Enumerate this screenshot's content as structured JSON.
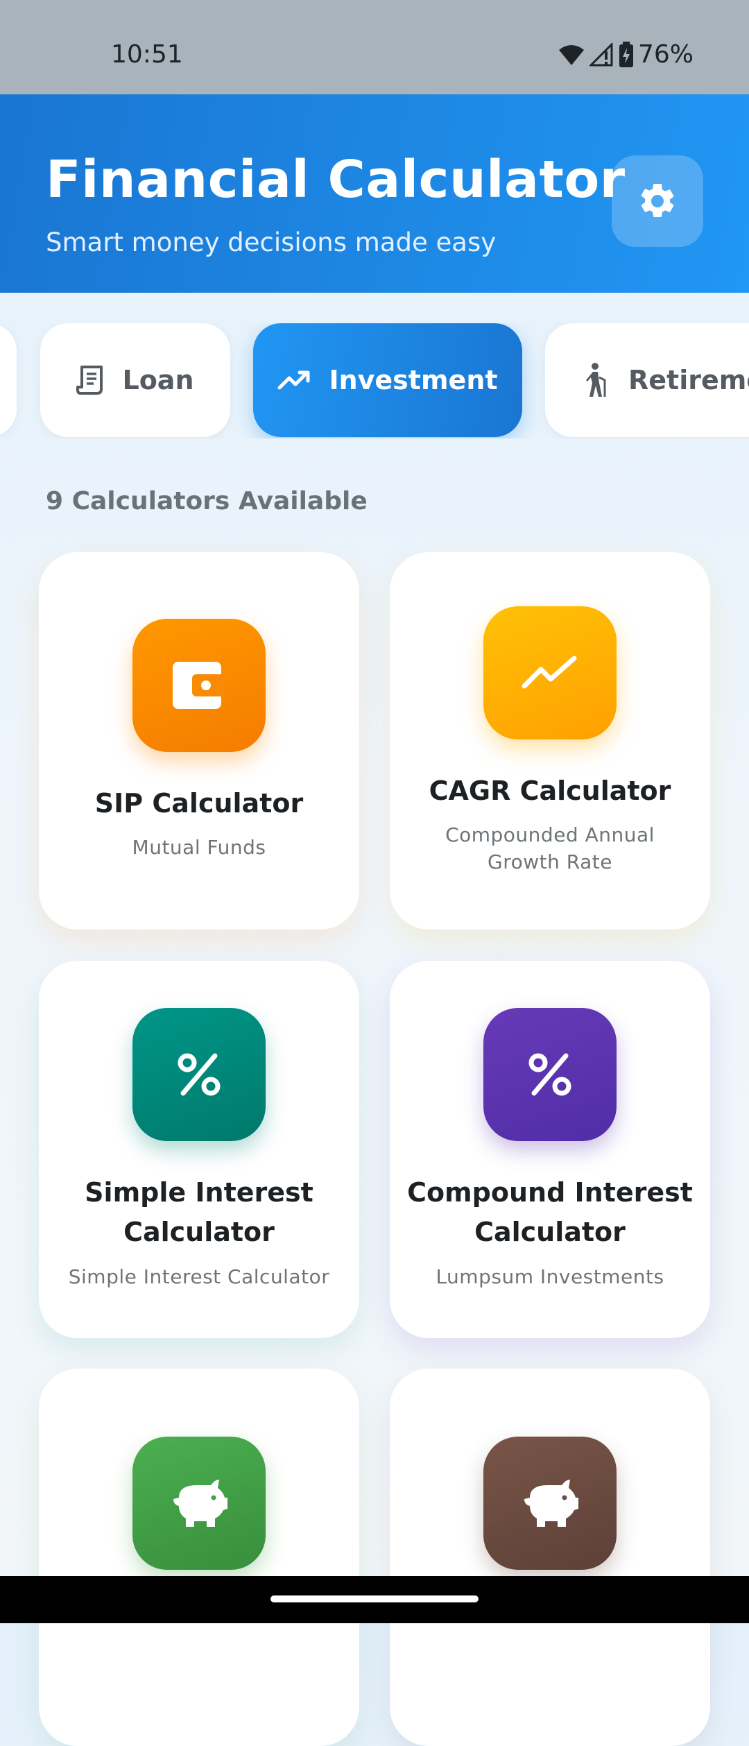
{
  "status_bar": {
    "time": "10:51",
    "battery": "76%"
  },
  "header": {
    "title": "Financial Calculator",
    "subtitle": "Smart money decisions made easy",
    "settings_icon": "gear-icon"
  },
  "tabs": [
    {
      "label": "Loan",
      "icon": "receipt-icon",
      "active": false
    },
    {
      "label": "Investment",
      "icon": "trending-up-icon",
      "active": true
    },
    {
      "label": "Retireme",
      "icon": "elderly-walking-icon",
      "active": false
    }
  ],
  "count_label": "9 Calculators Available",
  "cards": [
    {
      "title": "SIP Calculator",
      "subtitle": "Mutual Funds",
      "icon": "wallet-icon",
      "color": "#fb8c00"
    },
    {
      "title": "CAGR Calculator",
      "subtitle": "Compounded Annual Growth Rate",
      "icon": "trending-up-icon",
      "color": "#ffb300"
    },
    {
      "title": "Simple Interest Calculator",
      "subtitle": "Simple Interest Calculator",
      "icon": "percent-icon",
      "color": "#00897b"
    },
    {
      "title": "Compound Interest Calculator",
      "subtitle": "Lumpsum Investments",
      "icon": "percent-icon",
      "color": "#5e35b1"
    },
    {
      "title": "",
      "subtitle": "",
      "icon": "piggy-bank-icon",
      "color": "#43a047"
    },
    {
      "title": "",
      "subtitle": "",
      "icon": "piggy-bank-icon",
      "color": "#6d4c41"
    }
  ]
}
